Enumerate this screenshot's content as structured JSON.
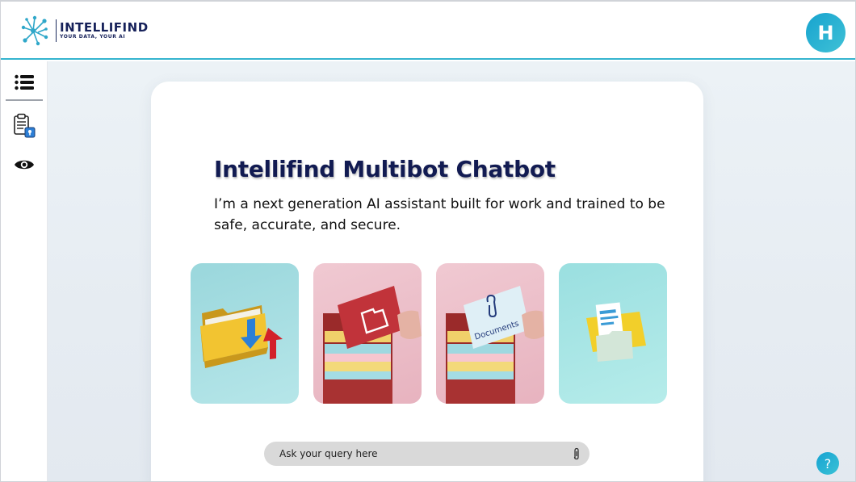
{
  "header": {
    "brand_name": "INTELLIFIND",
    "brand_tagline": "YOUR DATA, YOUR AI",
    "avatar_initial": "H",
    "accent_color": "#34b4cf"
  },
  "sidebar": {
    "items": [
      {
        "icon": "list-icon"
      },
      {
        "icon": "document-lock-icon"
      },
      {
        "icon": "eye-icon"
      }
    ]
  },
  "main": {
    "title": "Intellifind Multibot Chatbot",
    "subtitle": "I’m a next generation AI assistant built for work and trained to be safe, accurate, and secure.",
    "tiles": [
      {
        "icon": "folder-transfer-image"
      },
      {
        "icon": "folder-card-image"
      },
      {
        "icon": "documents-card-image",
        "label": "Documents"
      },
      {
        "icon": "open-folder-image"
      }
    ],
    "query_placeholder": "Ask your query here",
    "attach_icon": "paperclip-icon"
  },
  "help": {
    "label": "?"
  }
}
